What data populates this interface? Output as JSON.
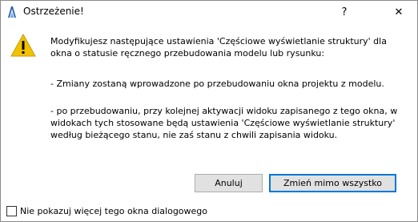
{
  "window": {
    "title": "Ostrzeżenie!",
    "help_label": "?",
    "close_label": "✕"
  },
  "icons": {
    "app": "archicad-logo-icon",
    "warning": "warning-triangle-icon",
    "warning_color": "#f2c200"
  },
  "message": {
    "paragraph1": "Modyfikujesz następujące ustawienia 'Częściowe wyświetlanie struktury' dla okna o statusie ręcznego przebudowania modelu lub rysunku:",
    "paragraph2": "- Zmiany zostaną wprowadzone po przebudowaniu okna projektu z modelu.",
    "paragraph3": "- po przebudowaniu, przy kolejnej aktywacji widoku zapisanego z tego okna, w widokach tych stosowane będą ustawienia 'Częściowe wyświetlanie struktury' według bieżącego stanu, nie zaś stanu z chwili zapisania widoku."
  },
  "buttons": {
    "cancel": "Anuluj",
    "ok": "Zmień mimo wszystko"
  },
  "checkbox": {
    "label": "Nie pokazuj więcej tego okna dialogowego",
    "checked": false
  }
}
